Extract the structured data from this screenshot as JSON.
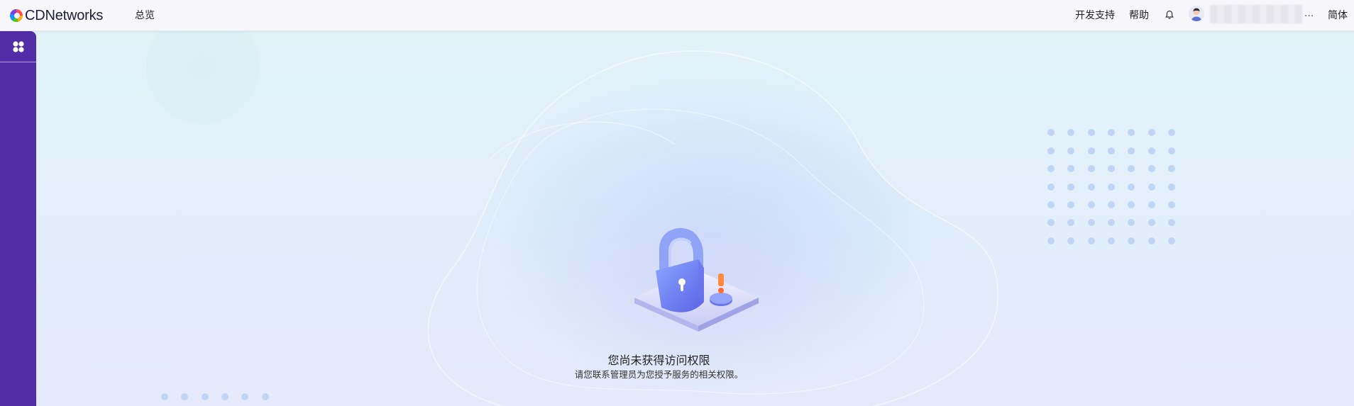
{
  "header": {
    "brand": "CDNetworks",
    "nav_overview": "总览",
    "dev_support": "开发支持",
    "help": "帮助",
    "username_ellipsis": "...",
    "language": "简体"
  },
  "sidebar": {
    "products_icon": "grid-four-icon"
  },
  "main": {
    "title": "您尚未获得访问权限",
    "subtitle": "请您联系管理员为您授予服务的相关权限。"
  },
  "colors": {
    "sidebar": "#512da8",
    "topbar": "#f7f7fb",
    "lock_blue": "#6f7cf2",
    "warning_orange": "#ff7a2e"
  }
}
